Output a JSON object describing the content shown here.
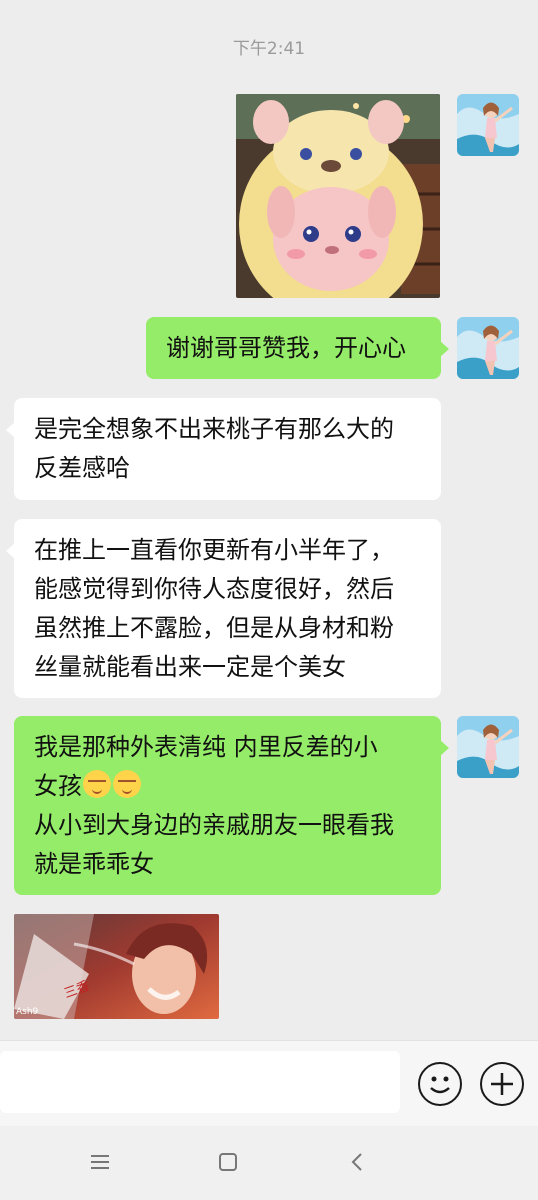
{
  "chat": {
    "timestamp": "下午2:41",
    "messages": [
      {
        "side": "right",
        "type": "image",
        "content": "plush-bunny-photo"
      },
      {
        "side": "right",
        "type": "text",
        "lines": [
          "谢谢哥哥赞我，开心心"
        ]
      },
      {
        "side": "left",
        "type": "text",
        "lines": [
          "是完全想象不出来桃子有那么大的",
          "反差感哈"
        ]
      },
      {
        "side": "left",
        "type": "text",
        "lines": [
          "在推上一直看你更新有小半年了，",
          "能感觉得到你待人态度很好，然后",
          "虽然推上不露脸，但是从身材和粉",
          "丝量就能看出来一定是个美女"
        ]
      },
      {
        "side": "right",
        "type": "text",
        "lines": [
          "我是那种外表清纯 内里反差的小",
          "女孩",
          "从小到大身边的亲戚朋友一眼看我",
          "就是乖乖女"
        ],
        "emoji": "blushing-face-emoji"
      },
      {
        "side": "left",
        "type": "image",
        "content": "anime-drawing"
      }
    ]
  },
  "photos": {
    "drawing_watermark": "Ash9",
    "drawing_stamp": "三香"
  },
  "icons": {
    "emoji_button": "smiley-icon",
    "more_button": "plus-icon",
    "nav_menu": "menu-icon",
    "nav_home": "square-icon",
    "nav_back": "back-chevron-icon"
  },
  "colors": {
    "background": "#ededed",
    "own_bubble": "#95ec69",
    "other_bubble": "#ffffff",
    "timestamp": "#9a9a9a"
  }
}
